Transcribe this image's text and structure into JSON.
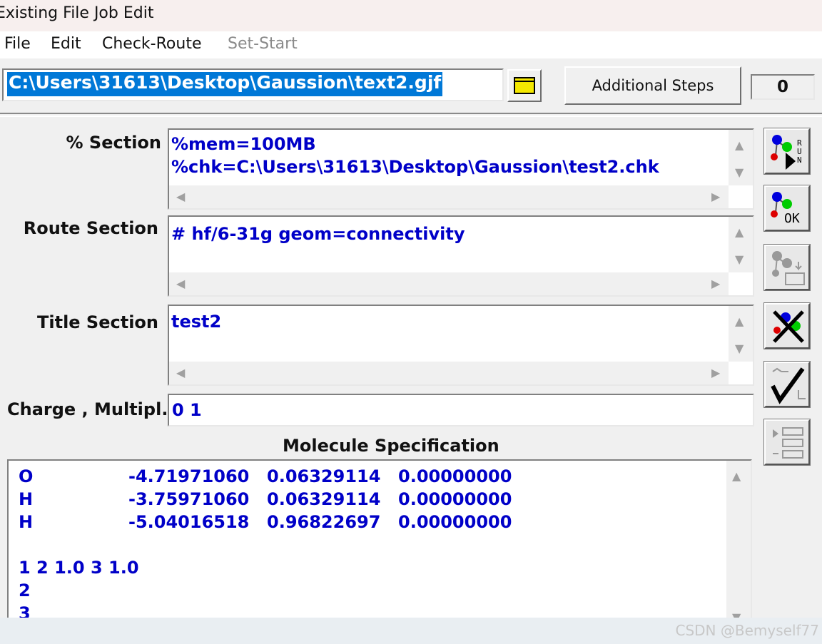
{
  "window": {
    "title": "Existing File Job Edit"
  },
  "menu": {
    "items": [
      "File",
      "Edit",
      "Check-Route",
      "Set-Start"
    ]
  },
  "file": {
    "path": "C:\\Users\\31613\\Desktop\\Gaussion\\text2.gjf"
  },
  "toolbar": {
    "additional_steps_label": "Additional Steps",
    "steps_count": "0"
  },
  "sections": {
    "percent": {
      "label": "% Section",
      "lines": [
        "%mem=100MB",
        "%chk=C:\\Users\\31613\\Desktop\\Gaussion\\test2.chk"
      ]
    },
    "route": {
      "label": "Route Section",
      "value": "# hf/6-31g geom=connectivity"
    },
    "title": {
      "label": "Title Section",
      "value": "test2"
    },
    "charge": {
      "label": "Charge , Multipl.",
      "value": "0 1"
    }
  },
  "molecule": {
    "heading": "Molecule Specification",
    "atoms": [
      [
        "O",
        "-4.71971060",
        "0.06329114",
        "0.00000000"
      ],
      [
        "H",
        "-3.75971060",
        "0.06329114",
        "0.00000000"
      ],
      [
        "H",
        "-5.04016518",
        "0.96822697",
        "0.00000000"
      ]
    ],
    "connectivity": [
      "1 2 1.0 3 1.0",
      "2",
      "3"
    ]
  },
  "side_buttons": [
    "run-button",
    "ok-button",
    "open-file-button",
    "cancel-button",
    "check-button",
    "list-button"
  ],
  "watermark": "CSDN @Bemyself77",
  "colors": {
    "text_blue": "#0000c8",
    "selection": "#0078d7",
    "folder_yellow": "#f4e800"
  }
}
